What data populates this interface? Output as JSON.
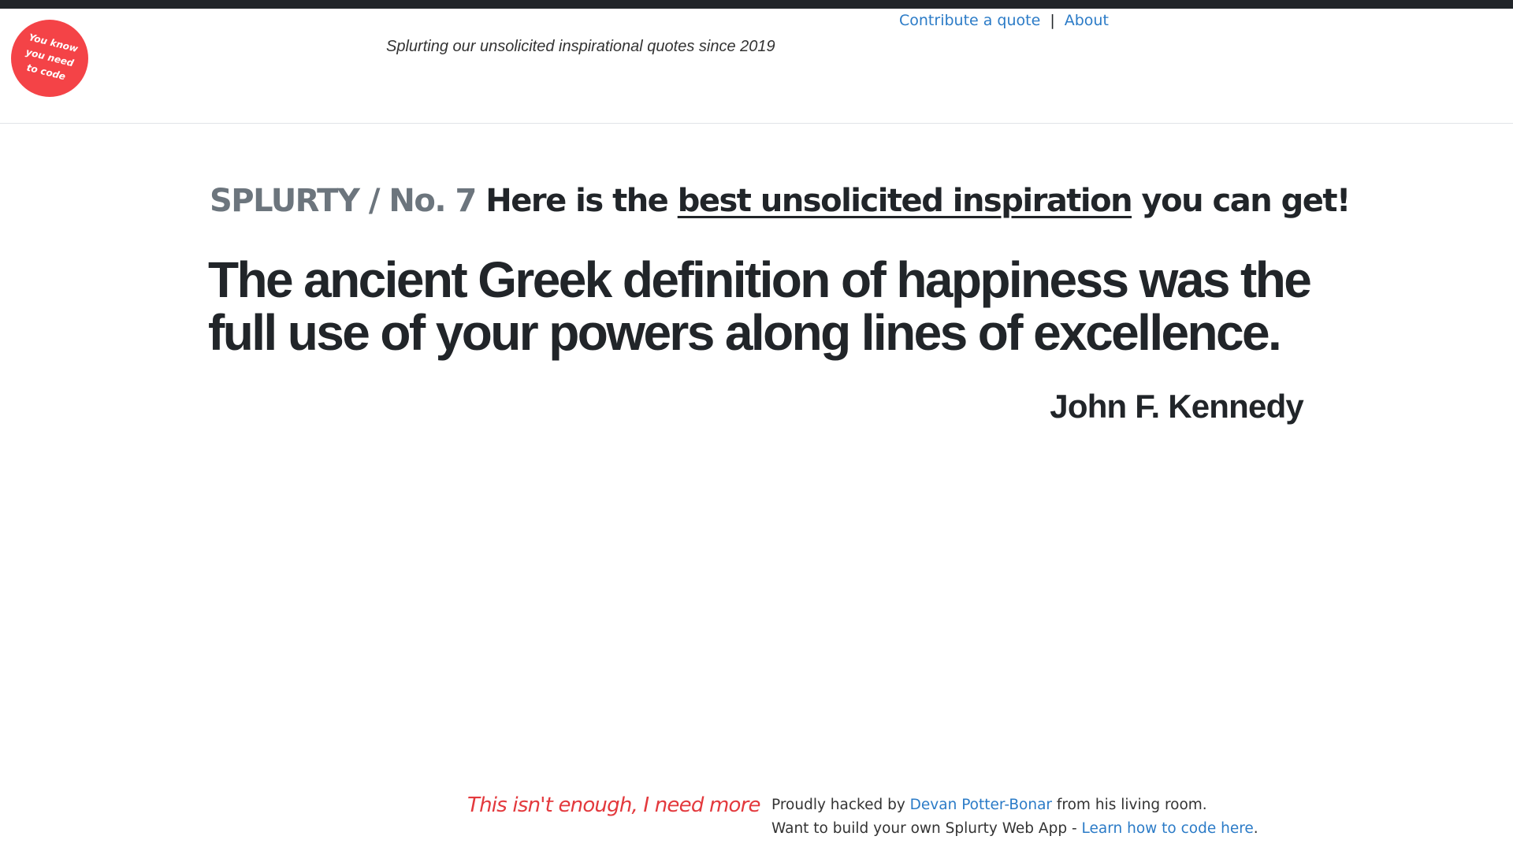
{
  "colors": {
    "topbar": "#212529",
    "logo_bg": "#f44347",
    "link": "#2b7bc7",
    "more_link": "#e3393d",
    "brand_gray": "#6c757d"
  },
  "logo": {
    "line1": "You know",
    "line2": "you need",
    "line3": "to code"
  },
  "header": {
    "tagline": "Splurting our unsolicited inspirational quotes since 2019"
  },
  "nav": {
    "contribute": "Contribute a quote",
    "separator": "|",
    "about": "About"
  },
  "headline": {
    "brand": "SPLURTY / No. 7",
    "prefix": "Here is the",
    "link": "best unsolicited inspiration",
    "suffix": "you can get!"
  },
  "quote": {
    "text": "The ancient Greek definition of happiness was the full use of your powers along lines of excellence.",
    "author": "John F. Kennedy"
  },
  "footer": {
    "more_link": "This isn't enough, I need more",
    "line1_prefix": "Proudly hacked by",
    "author_link": "Devan Potter-Bonar",
    "line1_suffix": "from his living room.",
    "line2_prefix": "Want to build your own Splurty Web App -",
    "learn_link": "Learn how to code here",
    "line2_suffix": "."
  }
}
